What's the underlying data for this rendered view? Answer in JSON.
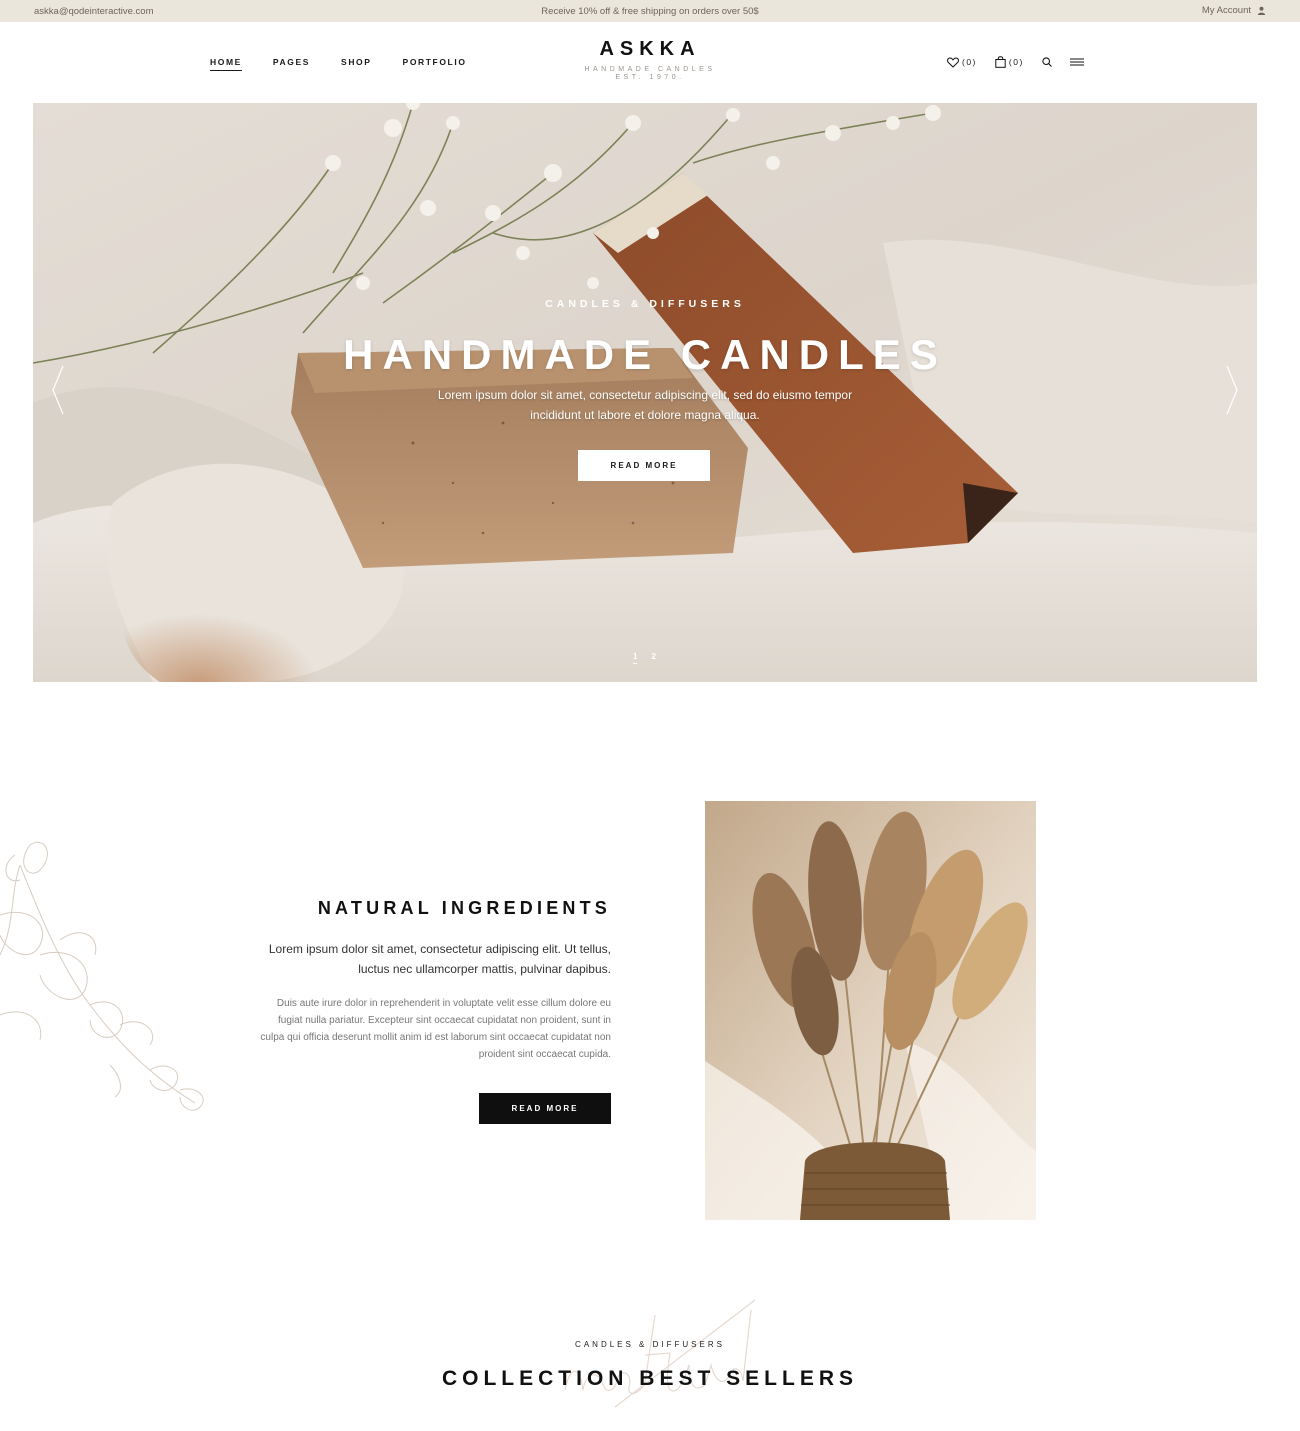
{
  "topbar": {
    "email": "askka@qodeinteractive.com",
    "promo": "Receive 10% off & free shipping on orders over 50$",
    "account_label": "My Account"
  },
  "header": {
    "nav": [
      "HOME",
      "PAGES",
      "SHOP",
      "PORTFOLIO"
    ],
    "active_nav": "HOME",
    "logo": {
      "brand": "ASKKA",
      "tagline": "HANDMADE CANDLES",
      "est": "EST. 1970."
    },
    "wishlist_count": "(0)",
    "cart_count": "(0)",
    "icons": [
      "heart-icon",
      "shopping-bag-icon",
      "search-icon",
      "hamburger-menu-icon"
    ]
  },
  "hero": {
    "eyebrow": "CANDLES & DIFFUSERS",
    "headline": "HANDMADE CANDLES",
    "subtext": "Lorem ipsum dolor sit amet, consectetur adipiscing elit, sed do eiusmo tempor incididunt ut labore et dolore magna aliqua.",
    "button": "READ MORE",
    "pages": [
      "1",
      "2"
    ],
    "active_page": "1"
  },
  "ingredients": {
    "title": "NATURAL INGREDIENTS",
    "lead": "Lorem ipsum dolor sit amet, consectetur adipiscing elit. Ut tellus, luctus nec ullamcorper mattis, pulvinar dapibus.",
    "body": "Duis aute irure dolor in reprehenderit in voluptate velit esse cillum dolore eu fugiat nulla pariatur. Excepteur sint occaecat cupidatat non proident, sunt in culpa qui officia deserunt mollit anim id est laborum sint occaecat cupidatat non proident sint occaecat cupida.",
    "button": "READ MORE"
  },
  "collection": {
    "eyebrow": "CANDLES & DIFFUSERS",
    "title": "COLLECTION BEST SELLERS",
    "script_word": "natural"
  },
  "colors": {
    "topbar_bg": "#ebe6dc",
    "text_dark": "#111111",
    "button_dark": "#0f0f0f",
    "muted": "#9a948c"
  }
}
